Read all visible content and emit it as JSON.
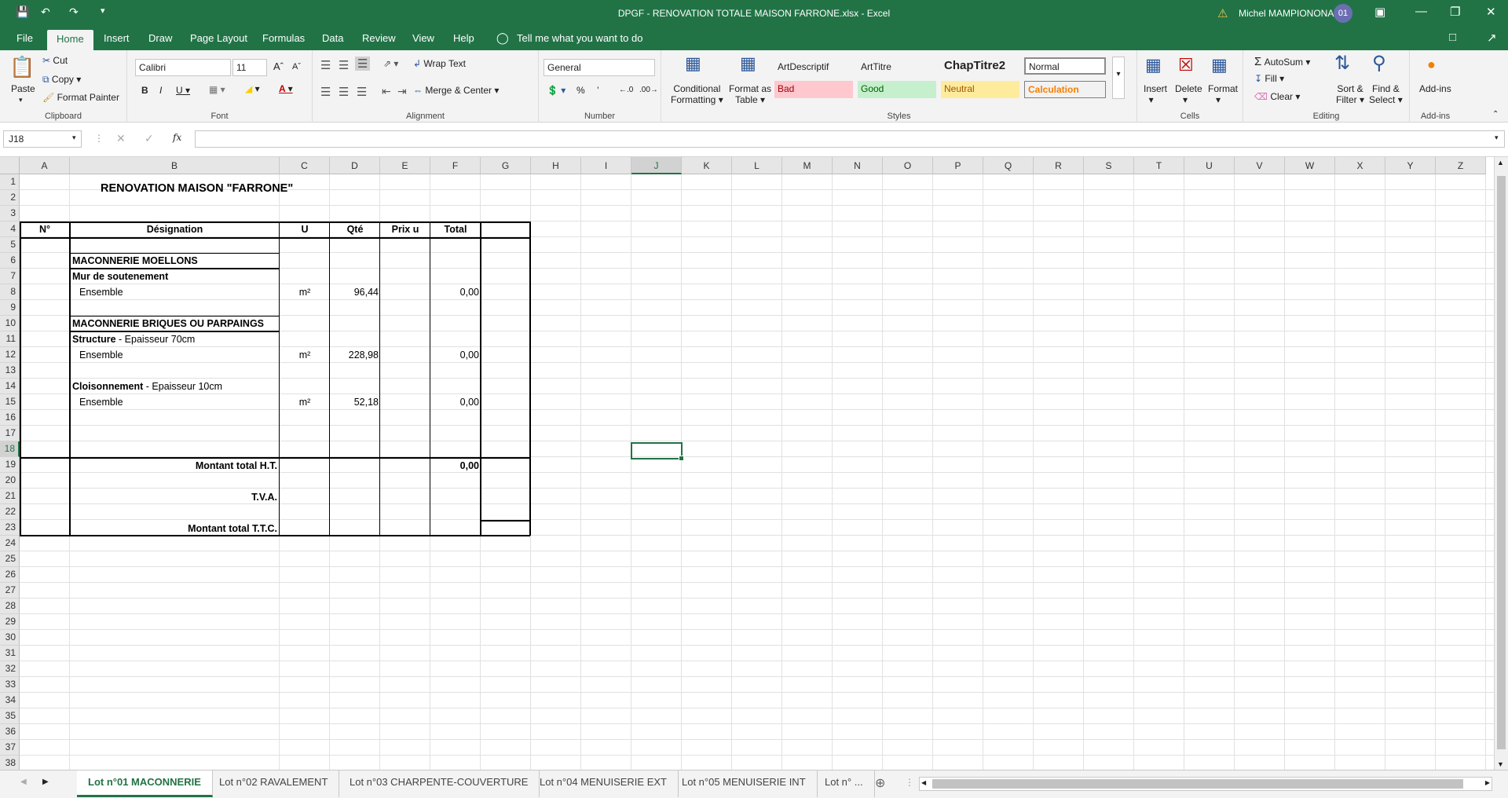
{
  "window": {
    "title": "DPGF - RENOVATION TOTALE MAISON FARRONE.xlsx  -  Excel",
    "user_name": "Michel MAMPIONONA",
    "user_initials": "01"
  },
  "ribbon_tabs": [
    "File",
    "Home",
    "Insert",
    "Draw",
    "Page Layout",
    "Formulas",
    "Data",
    "Review",
    "View",
    "Help"
  ],
  "tell_me": "Tell me what you want to do",
  "ribbon": {
    "clipboard": {
      "paste": "Paste",
      "cut": "Cut",
      "copy": "Copy",
      "format_painter": "Format Painter",
      "label": "Clipboard"
    },
    "font": {
      "name": "Calibri",
      "size": "11",
      "label": "Font"
    },
    "alignment": {
      "wrap_text": "Wrap Text",
      "merge_center": "Merge & Center",
      "label": "Alignment"
    },
    "number": {
      "format": "General",
      "label": "Number"
    },
    "styles": {
      "conditional": "Conditional",
      "conditional2": "Formatting",
      "format_table": "Format as",
      "format_table2": "Table",
      "items": [
        {
          "name": "ArtDescriptif",
          "bg": "#ffffff",
          "color": "#222222"
        },
        {
          "name": "ArtTitre",
          "bg": "#ffffff",
          "color": "#222222"
        },
        {
          "name": "ChapTitre2",
          "bg": "#ffffff",
          "color": "#000000"
        },
        {
          "name": "Normal",
          "bg": "#ffffff",
          "color": "#000000"
        },
        {
          "name": "Bad",
          "bg": "#ffc7ce",
          "color": "#9c0006"
        },
        {
          "name": "Good",
          "bg": "#c6efce",
          "color": "#006100"
        },
        {
          "name": "Neutral",
          "bg": "#ffeb9c",
          "color": "#9c5700"
        },
        {
          "name": "Calculation",
          "bg": "#f2f2f2",
          "color": "#fa7d00"
        }
      ],
      "label": "Styles"
    },
    "cells": {
      "insert": "Insert",
      "delete": "Delete",
      "format": "Format",
      "label": "Cells"
    },
    "editing": {
      "autosum": "AutoSum",
      "fill": "Fill",
      "clear": "Clear",
      "sort_filter": "Sort &",
      "sort_filter2": "Filter",
      "find_select": "Find &",
      "find_select2": "Select",
      "label": "Editing"
    },
    "addins": {
      "addins": "Add-ins",
      "label": "Add-ins"
    }
  },
  "formula_bar": {
    "name_box": "J18",
    "fx": "fx",
    "formula": ""
  },
  "columns": [
    "A",
    "B",
    "C",
    "D",
    "E",
    "F",
    "G",
    "H",
    "I",
    "J",
    "K",
    "L",
    "M",
    "N",
    "O",
    "P",
    "Q",
    "R",
    "S",
    "T",
    "U",
    "V",
    "W",
    "X",
    "Y",
    "Z"
  ],
  "rows": [
    "1",
    "2",
    "3",
    "4",
    "5",
    "6",
    "7",
    "8",
    "9",
    "10",
    "11",
    "12",
    "13",
    "14",
    "15",
    "16",
    "17",
    "18",
    "19",
    "20",
    "21",
    "22",
    "23",
    "24",
    "25",
    "26",
    "27",
    "28",
    "29",
    "30",
    "31",
    "32",
    "33",
    "34",
    "35",
    "36",
    "37",
    "38"
  ],
  "sheet": {
    "title": "RENOVATION MAISON \"FARRONE\"",
    "headers": {
      "n": "N°",
      "designation": "Désignation",
      "u": "U",
      "qte": "Qté",
      "prix": "Prix u",
      "total": "Total"
    },
    "section1": "MACONNERIE MOELLONS",
    "sub1": "Mur de soutenement",
    "item1": {
      "label": "Ensemble",
      "u": "m²",
      "qte": "96,44",
      "total": "0,00"
    },
    "section2": "MACONNERIE BRIQUES OU PARPAINGS",
    "sub2_bold": "Structure",
    "sub2_rest": " - Epaisseur 70cm",
    "item2": {
      "label": "Ensemble",
      "u": "m²",
      "qte": "228,98",
      "total": "0,00"
    },
    "sub3_bold": "Cloisonnement",
    "sub3_rest": " - Epaisseur 10cm",
    "item3": {
      "label": "Ensemble",
      "u": "m²",
      "qte": "52,18",
      "total": "0,00"
    },
    "total_ht_label": "Montant total H.T.",
    "total_ht": "0,00",
    "tva_label": "T.V.A.",
    "total_ttc_label": "Montant total T.T.C."
  },
  "sheet_tabs": [
    "Lot n°01 MACONNERIE",
    "Lot n°02 RAVALEMENT",
    "Lot n°03 CHARPENTE-COUVERTURE",
    "Lot n°04 MENUISERIE EXT",
    "Lot n°05 MENUISERIE INT",
    "Lot n° ..."
  ]
}
